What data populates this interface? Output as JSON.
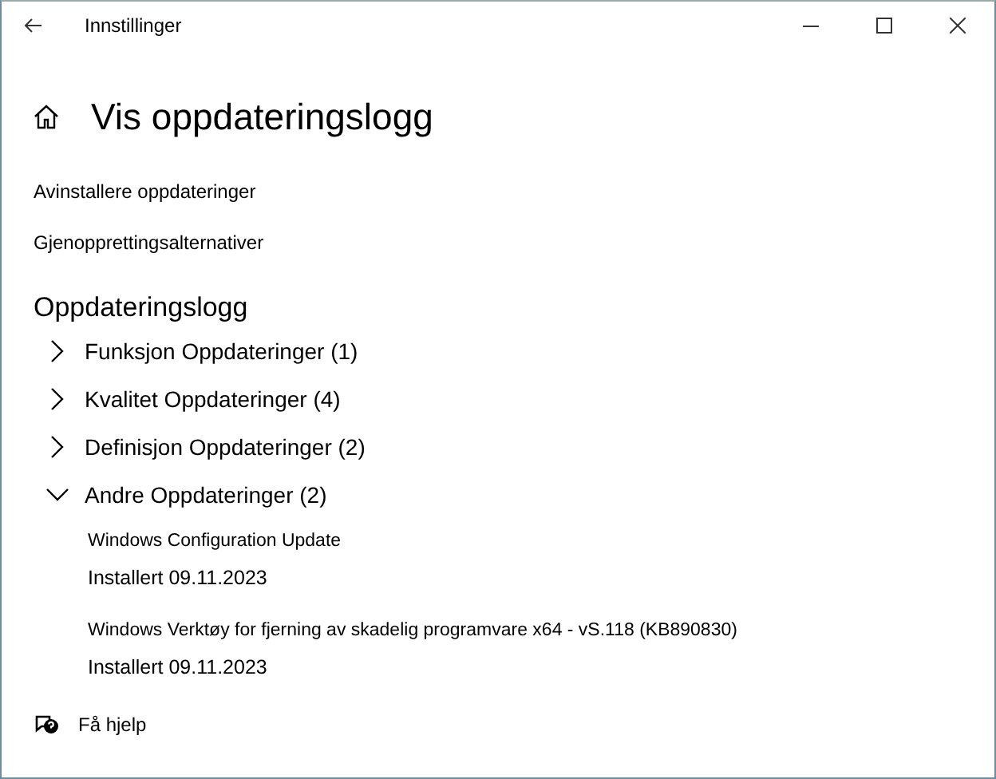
{
  "window": {
    "title": "Innstillinger"
  },
  "page": {
    "title": "Vis oppdateringslogg"
  },
  "links": [
    "Avinstallere oppdateringer",
    "Gjenopprettingsalternativer"
  ],
  "section": {
    "title": "Oppdateringslogg"
  },
  "groups": [
    {
      "label": "Funksjon Oppdateringer (1)",
      "expanded": false
    },
    {
      "label": "Kvalitet Oppdateringer (4)",
      "expanded": false
    },
    {
      "label": "Definisjon Oppdateringer (2)",
      "expanded": false
    },
    {
      "label": "Andre Oppdateringer (2)",
      "expanded": true,
      "children": [
        {
          "name": "Windows Configuration Update",
          "status": "Installert 09.11.2023"
        },
        {
          "name": "Windows Verktøy for fjerning av skadelig programvare x64 - vS.118 (KB890830)",
          "status": "Installert 09.11.2023"
        }
      ]
    }
  ],
  "help": {
    "label": "Få hjelp"
  }
}
